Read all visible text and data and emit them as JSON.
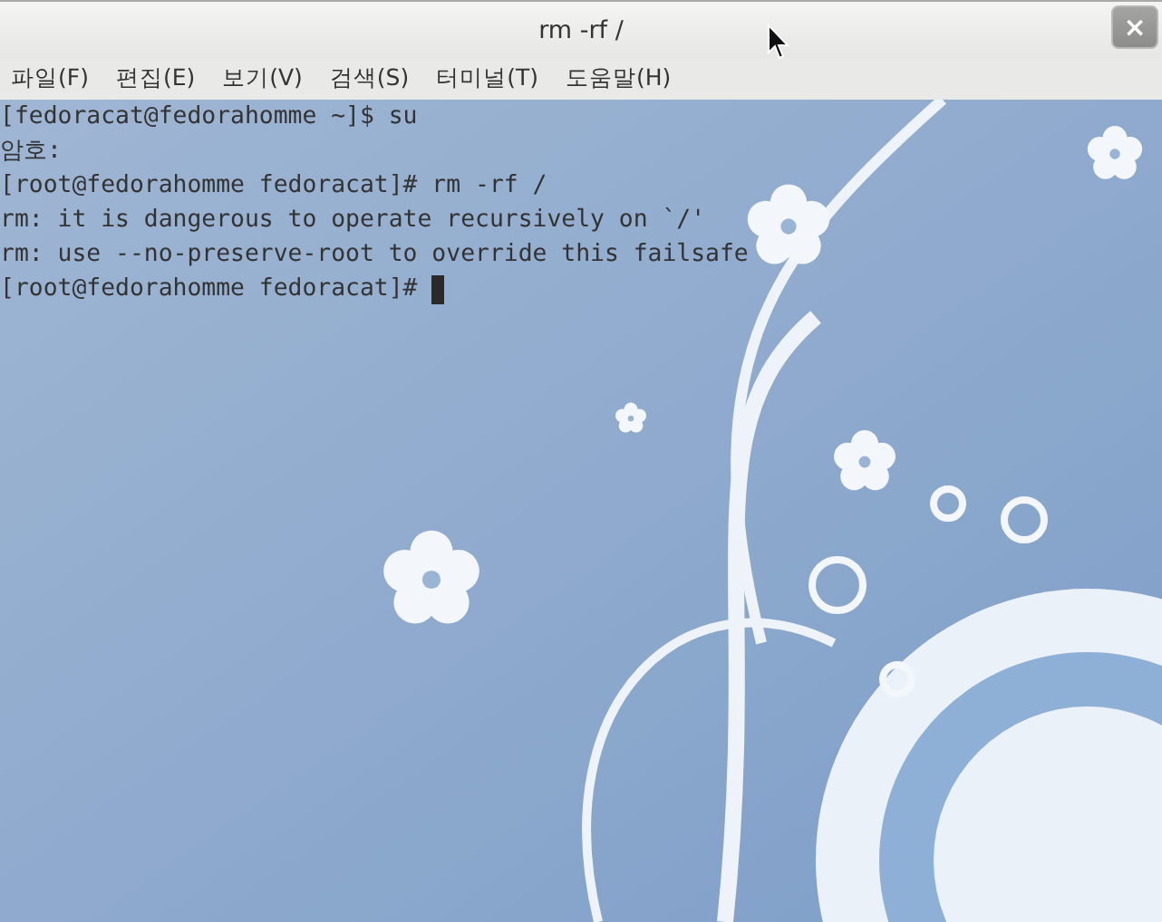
{
  "window": {
    "title": "rm -rf /",
    "close": "×"
  },
  "menu": [
    {
      "label": "파일(F)"
    },
    {
      "label": "편집(E)"
    },
    {
      "label": "보기(V)"
    },
    {
      "label": "검색(S)"
    },
    {
      "label": "터미널(T)"
    },
    {
      "label": "도움말(H)"
    }
  ],
  "terminal": {
    "lines": [
      "[fedoracat@fedorahomme ~]$ su",
      "암호:",
      "[root@fedorahomme fedoracat]# rm -rf /",
      "rm: it is dangerous to operate recursively on `/'",
      "rm: use --no-preserve-root to override this failsafe"
    ],
    "prompt": "[root@fedorahomme fedoracat]# "
  }
}
